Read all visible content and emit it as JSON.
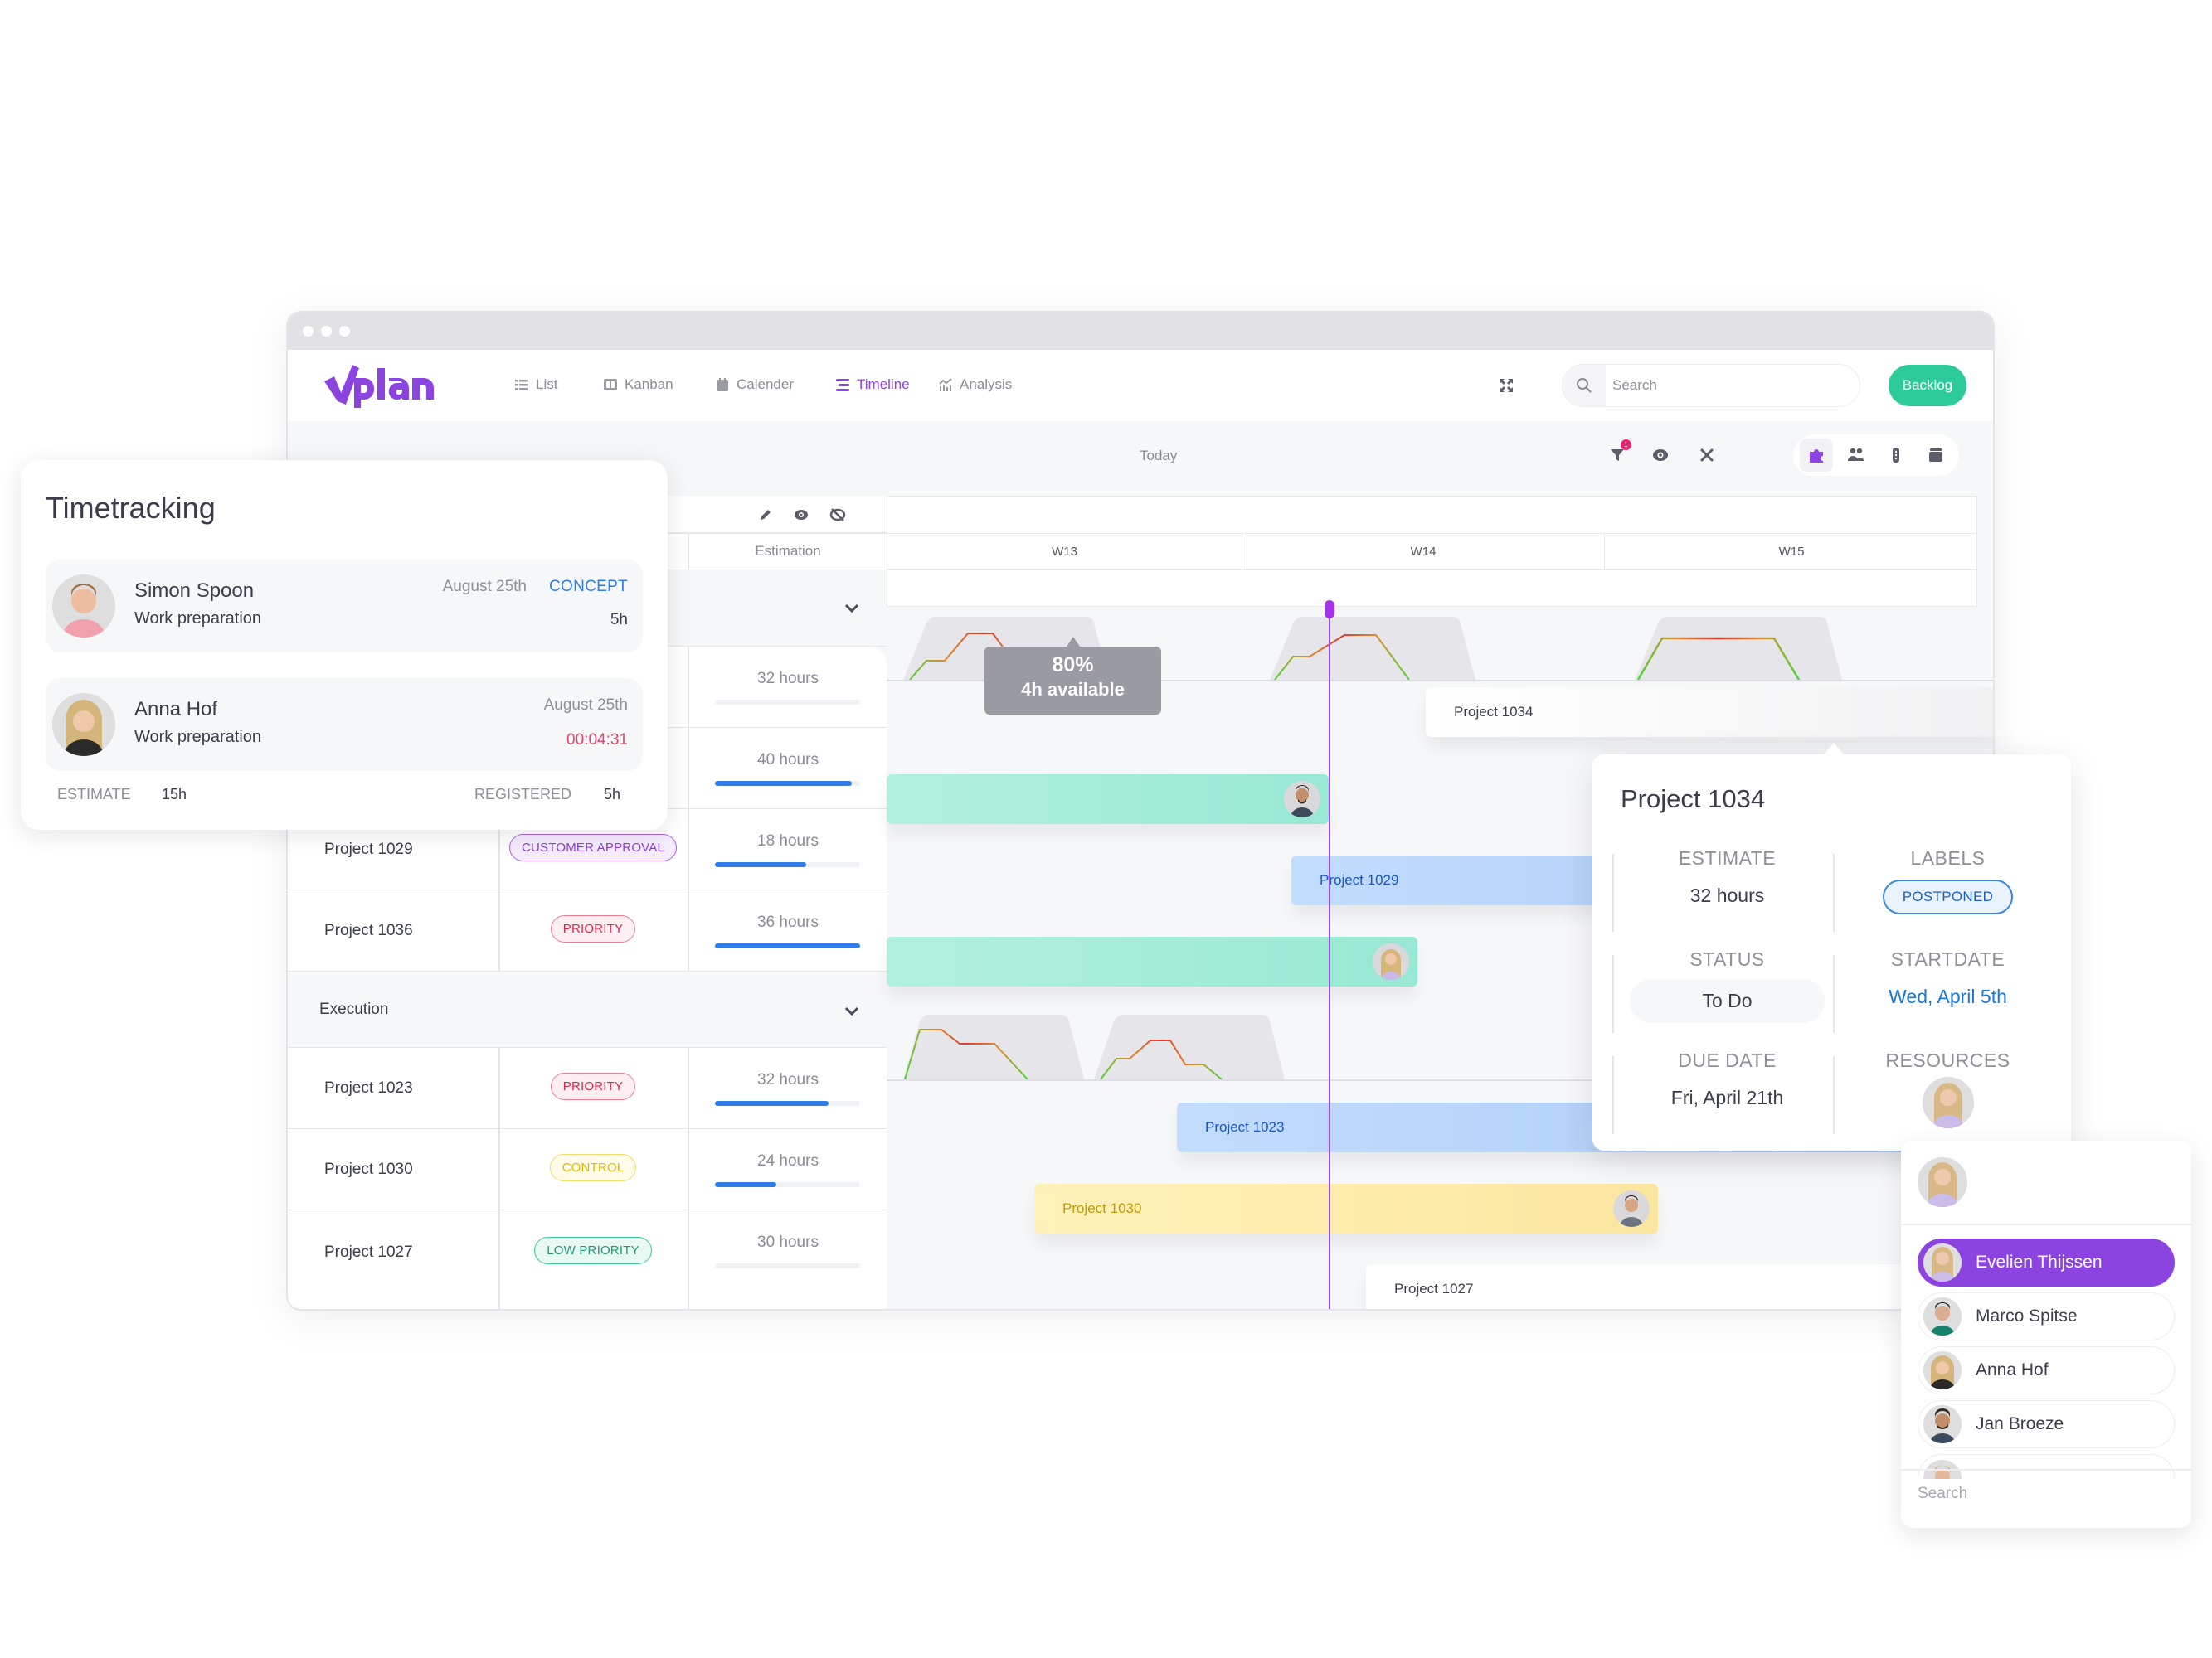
{
  "app": {
    "brand": "vplan",
    "accent": "#8c44e0"
  },
  "nav": {
    "items": [
      {
        "label": "List",
        "icon": "list-icon",
        "active": false
      },
      {
        "label": "Kanban",
        "icon": "kanban-icon",
        "active": false
      },
      {
        "label": "Calender",
        "icon": "calendar-icon",
        "active": false
      },
      {
        "label": "Timeline",
        "icon": "timeline-icon",
        "active": true
      },
      {
        "label": "Analysis",
        "icon": "analysis-icon",
        "active": false
      }
    ],
    "search_placeholder": "Search",
    "backlog_label": "Backlog"
  },
  "toolbar": {
    "today_label": "Today",
    "filter_badge": "1",
    "icons": [
      "filter-icon",
      "eye-icon",
      "tools-icon"
    ],
    "segments": [
      "puzzle-icon",
      "team-icon",
      "phase-icon",
      "archive-icon"
    ]
  },
  "table": {
    "estimation_header": "Estimation",
    "group1_rows": [
      {
        "hours": "32 hours",
        "progress": 0
      },
      {
        "hours": "40 hours",
        "progress": 0.94
      },
      {
        "name": "Project 1029",
        "tag": "CUSTOMER APPROVAL",
        "tag_type": "approval",
        "hours": "18 hours",
        "progress": 0.63
      },
      {
        "name": "Project 1036",
        "tag": "PRIORITY",
        "tag_type": "priority",
        "hours": "36 hours",
        "progress": 1.0
      }
    ],
    "group2": {
      "label": "Execution",
      "rows": [
        {
          "name": "Project 1023",
          "tag": "PRIORITY",
          "tag_type": "priority",
          "hours": "32 hours",
          "progress": 0.78
        },
        {
          "name": "Project 1030",
          "tag": "CONTROL",
          "tag_type": "control",
          "hours": "24 hours",
          "progress": 0.42
        },
        {
          "name": "Project 1027",
          "tag": "LOW PRIORITY",
          "tag_type": "low",
          "hours": "30 hours",
          "progress": 0
        }
      ]
    }
  },
  "timeline": {
    "weeks": [
      "W13",
      "W14",
      "W15"
    ],
    "load_tooltip": {
      "percent": "80%",
      "available": "4h available"
    },
    "bars": [
      {
        "label": "Project 1034",
        "color": "white"
      },
      {
        "label": "",
        "color": "green",
        "avatar": "jan"
      },
      {
        "label": "Project 1029",
        "color": "blue"
      },
      {
        "label": "",
        "color": "green",
        "avatar": "evelien"
      },
      {
        "label": "Project 1023",
        "color": "blue"
      },
      {
        "label": "Project 1030",
        "color": "yellow",
        "avatar": "marco"
      },
      {
        "label": "Project 1027",
        "color": "white"
      }
    ]
  },
  "timetracking": {
    "title": "Timetracking",
    "entries": [
      {
        "name": "Simon Spoon",
        "task": "Work preparation",
        "date": "August 25th",
        "status": "CONCEPT",
        "duration": "5h"
      },
      {
        "name": "Anna Hof",
        "task": "Work preparation",
        "date": "August 25th",
        "timer": "00:04:31"
      }
    ],
    "estimate_label": "ESTIMATE",
    "estimate_value": "15h",
    "registered_label": "REGISTERED",
    "registered_value": "5h"
  },
  "detail": {
    "title": "Project 1034",
    "estimate_label": "ESTIMATE",
    "estimate_value": "32 hours",
    "labels_label": "LABELS",
    "label_value": "POSTPONED",
    "status_label": "STATUS",
    "status_value": "To Do",
    "startdate_label": "STARTDATE",
    "startdate_value": "Wed, April 5th",
    "duedate_label": "DUE DATE",
    "duedate_value": "Fri, April 21th",
    "resources_label": "RESOURCES"
  },
  "resources": {
    "people": [
      {
        "name": "Evelien Thijssen",
        "selected": true
      },
      {
        "name": "Marco Spitse",
        "selected": false
      },
      {
        "name": "Anna Hof",
        "selected": false
      },
      {
        "name": "Jan Broeze",
        "selected": false
      }
    ],
    "search_placeholder": "Search"
  }
}
